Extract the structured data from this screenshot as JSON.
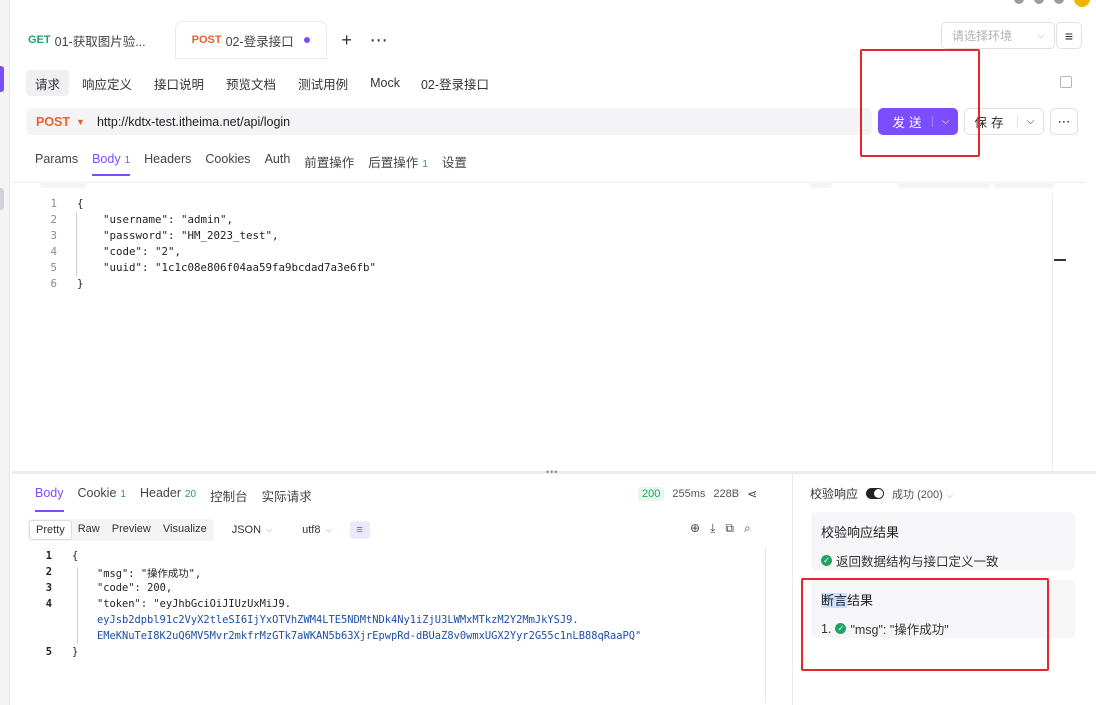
{
  "tabs": [
    {
      "method": "GET",
      "label": "01-获取图片验..."
    },
    {
      "method": "POST",
      "label": "02-登录接口"
    }
  ],
  "env": {
    "placeholder": "请选择环境"
  },
  "sub_tabs": [
    "请求",
    "响应定义",
    "接口说明",
    "预览文档",
    "测试用例",
    "Mock"
  ],
  "sub_title": "02-登录接口",
  "request": {
    "method": "POST",
    "url": "http://kdtx-test.itheima.net/api/login"
  },
  "buttons": {
    "send": "发送",
    "save": "保存"
  },
  "param_tabs": [
    {
      "label": "Params",
      "badge": ""
    },
    {
      "label": "Body",
      "badge": "1"
    },
    {
      "label": "Headers",
      "badge": ""
    },
    {
      "label": "Cookies",
      "badge": ""
    },
    {
      "label": "Auth",
      "badge": ""
    },
    {
      "label": "前置操作",
      "badge": ""
    },
    {
      "label": "后置操作",
      "badge": "1"
    },
    {
      "label": "设置",
      "badge": ""
    }
  ],
  "body_lines": [
    {
      "n": "1",
      "text": "{"
    },
    {
      "n": "2",
      "text": "    \"username\": \"admin\","
    },
    {
      "n": "3",
      "text": "    \"password\": \"HM_2023_test\","
    },
    {
      "n": "4",
      "text": "    \"code\": \"2\","
    },
    {
      "n": "5",
      "text": "    \"uuid\": \"1c1c08e806f04aa59fa9bcdad7a3e6fb\""
    },
    {
      "n": "6",
      "text": "}"
    }
  ],
  "response_tabs": [
    {
      "label": "Body",
      "badge": ""
    },
    {
      "label": "Cookie",
      "badge": "1"
    },
    {
      "label": "Header",
      "badge": "20"
    },
    {
      "label": "控制台",
      "badge": ""
    },
    {
      "label": "实际请求",
      "badge": ""
    }
  ],
  "response_meta": {
    "status": "200",
    "time": "255ms",
    "size": "228B"
  },
  "view_options": [
    "Pretty",
    "Raw",
    "Preview",
    "Visualize"
  ],
  "format": {
    "type": "JSON",
    "encoding": "utf8"
  },
  "response_lines": [
    {
      "n": "1",
      "text": "{"
    },
    {
      "n": "2",
      "text": "    \"msg\": \"操作成功\","
    },
    {
      "n": "3",
      "text": "    \"code\": 200,"
    },
    {
      "n": "4",
      "text": "    \"token\": \"eyJhbGciOiJIUzUxMiJ9."
    },
    {
      "n": "",
      "text": "eyJsb2dpbl91c2VyX2tleSI6IjYxOTVhZWM4LTE5NDMtNDk4Ny1iZjU3LWMxMTkzM2Y2MmJkYSJ9."
    },
    {
      "n": "",
      "text": "EMeKNuTeI8K2uQ6MV5Mvr2mkfrMzGTk7aWKAN5b63XjrEpwpRd-dBUaZ8v0wmxUGX2Yyr2G55c1nLB88qRaaPQ\""
    },
    {
      "n": "5",
      "text": "}"
    }
  ],
  "validation": {
    "toggle_label": "校验响应",
    "status": "成功 (200)",
    "result_title": "校验响应结果",
    "result_text": "返回数据结构与接口定义一致"
  },
  "assertion": {
    "title_highlight": "断言",
    "title_rest": "结果",
    "item_index": "1.",
    "item_text": "\"msg\": \"操作成功\""
  },
  "colors": {
    "accent": "#7c4dff",
    "post": "#e8622c",
    "get": "#21a366",
    "highlight_box": "#e5262c"
  }
}
